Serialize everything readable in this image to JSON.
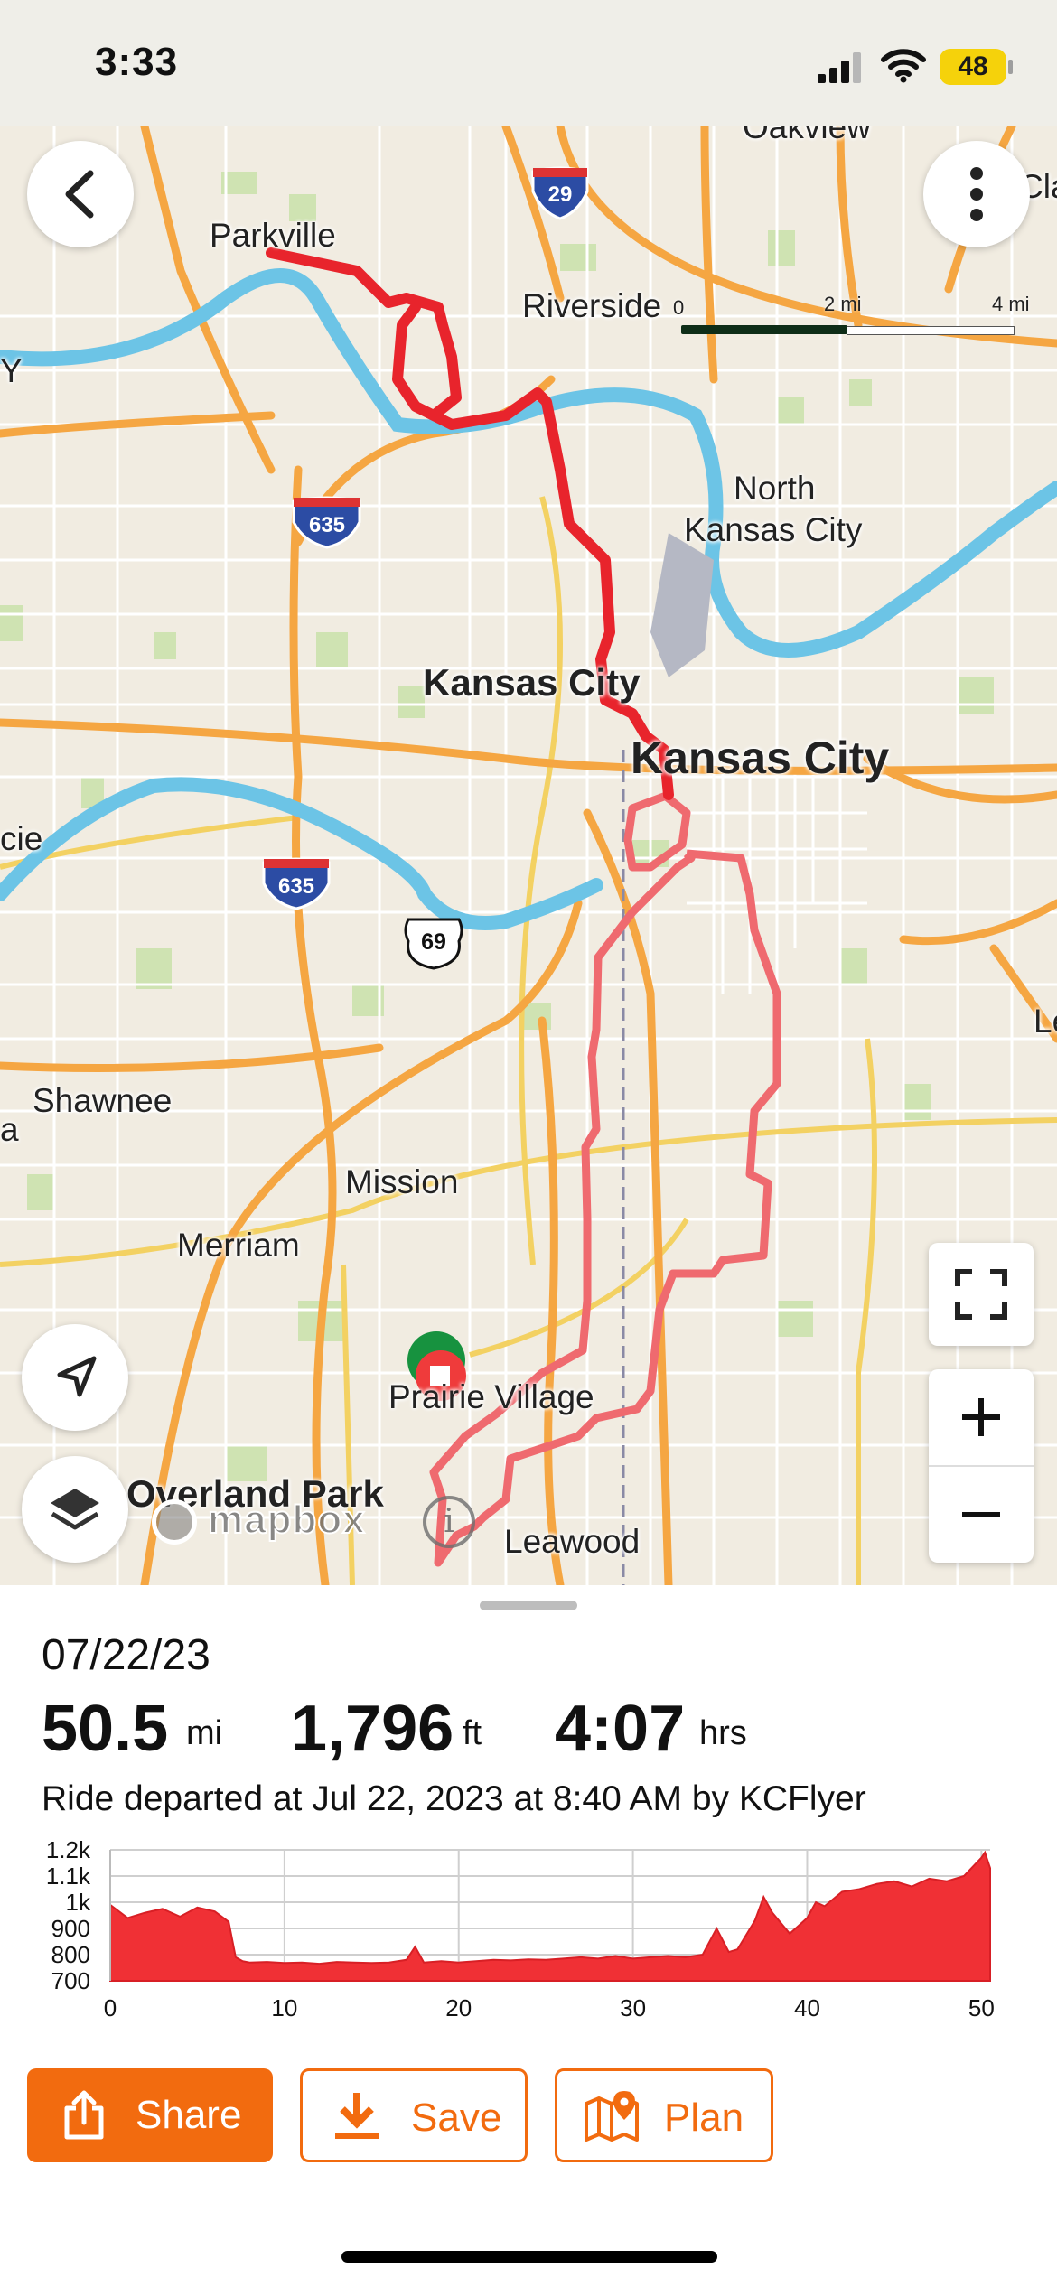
{
  "status_bar": {
    "time": "3:33",
    "battery": "48"
  },
  "map": {
    "labels": {
      "oakview": "Oakview",
      "cla": "Cla",
      "parkville": "Parkville",
      "riverside": "Riverside",
      "north_kc_1": "North",
      "north_kc_2": "Kansas City",
      "kansas_city_ks": "Kansas City",
      "kansas_city_mo": "Kansas City",
      "cie": "cie",
      "shawnee": "Shawnee",
      "mission": "Mission",
      "merriam": "Merriam",
      "prairie_village": "Prairie Village",
      "overland_park": "Overland Park",
      "leawood": "Leawood",
      "edge_y": "Y",
      "edge_le": "Le",
      "edge_a": "a"
    },
    "shields": {
      "i29": "29",
      "i635_top": "635",
      "i635_bottom": "635",
      "us69": "69"
    },
    "scale": {
      "zero": "0",
      "mid": "2 mi",
      "end": "4 mi"
    },
    "attribution": "mapbox",
    "info_glyph": "i"
  },
  "ride": {
    "date": "07/22/23",
    "distance_value": "50.5",
    "distance_unit": "mi",
    "elevation_value": "1,796",
    "elevation_unit": "ft",
    "time_value": "4:07",
    "time_unit": "hrs",
    "description": "Ride departed at Jul 22, 2023 at 8:40 AM by KCFlyer"
  },
  "elevation_chart": {
    "y_ticks": [
      "1.2k",
      "1.1k",
      "1k",
      "900",
      "800",
      "700"
    ],
    "x_ticks": [
      "0",
      "10",
      "20",
      "30",
      "40",
      "50"
    ]
  },
  "chart_data": {
    "type": "area",
    "title": "",
    "xlabel": "",
    "ylabel": "",
    "xlim": [
      0,
      50.5
    ],
    "ylim": [
      700,
      1200
    ],
    "x": [
      0,
      1,
      2,
      3,
      4,
      5,
      6,
      6.8,
      7.2,
      7.6,
      8,
      9,
      10,
      11,
      12,
      13,
      14,
      15,
      16,
      17,
      17.5,
      18,
      19,
      20,
      21,
      22,
      23,
      24,
      25,
      26,
      27,
      28,
      29,
      30,
      31,
      32,
      33,
      34,
      34.8,
      35.5,
      36,
      37,
      37.5,
      38,
      39,
      40,
      40.5,
      41,
      42,
      43,
      44,
      45,
      46,
      47,
      48,
      49,
      50,
      50.2,
      50.5
    ],
    "values": [
      990,
      940,
      960,
      975,
      945,
      980,
      965,
      925,
      790,
      775,
      770,
      772,
      768,
      770,
      765,
      772,
      770,
      768,
      770,
      780,
      830,
      770,
      775,
      770,
      775,
      780,
      778,
      782,
      780,
      785,
      790,
      785,
      795,
      785,
      790,
      795,
      790,
      800,
      900,
      810,
      820,
      930,
      1020,
      960,
      880,
      940,
      1000,
      985,
      1040,
      1050,
      1070,
      1080,
      1060,
      1090,
      1080,
      1100,
      1170,
      1190,
      1130
    ],
    "series": [
      {
        "values": "see values"
      }
    ]
  },
  "buttons": {
    "share": "Share",
    "save": "Save",
    "plan": "Plan"
  },
  "colors": {
    "accent": "#f26b0f",
    "route_red": "#e8242c",
    "route_pink": "#ef6a6f",
    "elevation_fill": "#f03035",
    "start_marker": "#17923f"
  }
}
